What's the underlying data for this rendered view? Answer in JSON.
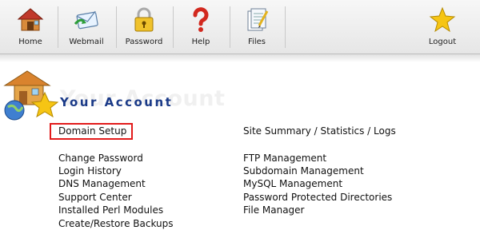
{
  "toolbar": {
    "items": [
      {
        "label": "Home",
        "icon": "home-icon"
      },
      {
        "label": "Webmail",
        "icon": "envelope-icon"
      },
      {
        "label": "Password",
        "icon": "padlock-icon"
      },
      {
        "label": "Help",
        "icon": "question-mark-icon"
      },
      {
        "label": "Files",
        "icon": "files-icon"
      },
      {
        "label": "Logout",
        "icon": "star-icon"
      }
    ]
  },
  "header": {
    "title": "Your Account",
    "ghost_text": "Your Account",
    "icon": "account-house-globe-star-icon"
  },
  "links": {
    "highlighted": "Domain Setup",
    "right_top": "Site Summary / Statistics / Logs",
    "left": [
      "Change Password",
      "Login History",
      "DNS Management",
      "Support Center",
      "Installed Perl Modules",
      "Create/Restore Backups"
    ],
    "right": [
      "FTP Management",
      "Subdomain Management",
      "MySQL Management",
      "Password Protected Directories",
      "File Manager"
    ]
  },
  "colors": {
    "title": "#1a3a88",
    "highlight_border": "#e21b1b"
  }
}
